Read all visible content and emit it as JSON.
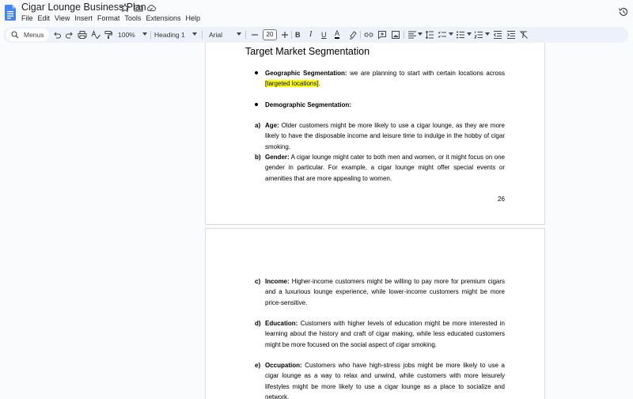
{
  "document": {
    "title": "Cigar Lounge Business Plan"
  },
  "menubar": [
    "File",
    "Edit",
    "View",
    "Insert",
    "Format",
    "Tools",
    "Extensions",
    "Help"
  ],
  "toolbar": {
    "search_label": "Menus",
    "zoom": "100%",
    "style": "Heading 1",
    "font": "Arial",
    "font_size": "20",
    "bold": "B",
    "italic": "I",
    "underline": "U",
    "text_color": "A"
  },
  "page1": {
    "heading": "Target Market Segmentation",
    "geo_label": "Geographic Segmentation:",
    "geo_text": " we are planning to start with certain locations across ",
    "geo_highlight": "[targeted locations]",
    "geo_end": ".",
    "demo_label": "Demographic Segmentation:",
    "a_marker": "a)",
    "a_label": "Age:",
    "a_text": " Older customers might be more likely to use a cigar lounge, as they are more likely to have the disposable income and leisure time to indulge in the hobby of cigar smoking.",
    "b_marker": "b)",
    "b_label": "Gender:",
    "b_text": " A cigar lounge might cater to both men and women, or it might focus on one gender in particular. For example, a cigar lounge might offer special events or amenities that are more appealing to women.",
    "page_number": "26"
  },
  "page2": {
    "c_marker": "c)",
    "c_label": "Income:",
    "c_text": " Higher-income customers might be willing to pay more for premium cigars and a luxurious lounge experience, while lower-income customers might be more price-sensitive.",
    "d_marker": "d)",
    "d_label": "Education:",
    "d_text": " Customers with higher levels of education might be more interested in learning about the history and craft of cigar making, while less educated customers might be more focused on the social aspect of cigar smoking.",
    "e_marker": "e)",
    "e_label": "Occupation:",
    "e_text": " Customers who have high-stress jobs might be more likely to use a cigar lounge as a way to relax and unwind, while customers with more leisurely lifestyles might be more likely to use a cigar lounge as a place to socialize and network."
  },
  "colors": {
    "accent": "#1a73e8",
    "toolbar_bg": "#edf2fa",
    "highlight": "#ffff00"
  },
  "icons": [
    "docs-logo-icon",
    "star-icon",
    "move-folder-icon",
    "cloud-saved-icon",
    "history-icon",
    "search-icon",
    "undo-icon",
    "redo-icon",
    "print-icon",
    "spellcheck-icon",
    "paint-format-icon",
    "highlighter-icon",
    "link-icon",
    "comment-icon",
    "image-icon",
    "align-icon",
    "line-spacing-icon",
    "checklist-icon",
    "bulleted-list-icon",
    "numbered-list-icon",
    "decrease-indent-icon",
    "increase-indent-icon",
    "clear-formatting-icon"
  ]
}
